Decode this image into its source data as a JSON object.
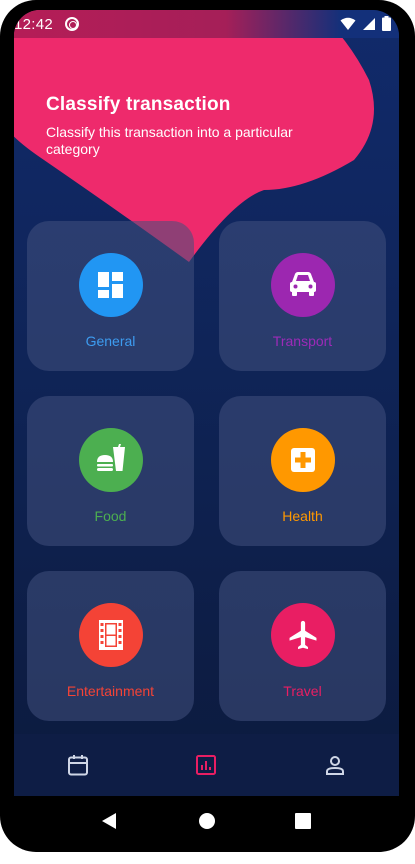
{
  "status_bar": {
    "time": "12:42",
    "icons": [
      "app-notification-icon",
      "wifi-icon",
      "signal-icon",
      "battery-icon"
    ]
  },
  "header": {
    "title": "Classify transaction",
    "subtitle": "Classify this transaction into a particular category"
  },
  "categories": [
    {
      "label": "General",
      "icon": "dashboard-icon",
      "color": "#2196F3",
      "text_color": "#3d9cf0"
    },
    {
      "label": "Transport",
      "icon": "car-icon",
      "color": "#9C27B0",
      "text_color": "#9c2bb8"
    },
    {
      "label": "Food",
      "icon": "fastfood-icon",
      "color": "#4CAF50",
      "text_color": "#4caf50"
    },
    {
      "label": "Health",
      "icon": "medical-cross-icon",
      "color": "#FF9800",
      "text_color": "#ff9800"
    },
    {
      "label": "Entertainment",
      "icon": "film-icon",
      "color": "#F44336",
      "text_color": "#f44336"
    },
    {
      "label": "Travel",
      "icon": "airplane-icon",
      "color": "#E91E63",
      "text_color": "#e91e63"
    }
  ],
  "bottom_nav": {
    "items": [
      "calendar-icon",
      "stats-icon",
      "profile-icon"
    ],
    "active_color": "#e91e63",
    "inactive_color": "#cfd6e6"
  },
  "colors": {
    "blob": "#f0306f",
    "background": "#0f2457",
    "card": "#3a4a78"
  }
}
